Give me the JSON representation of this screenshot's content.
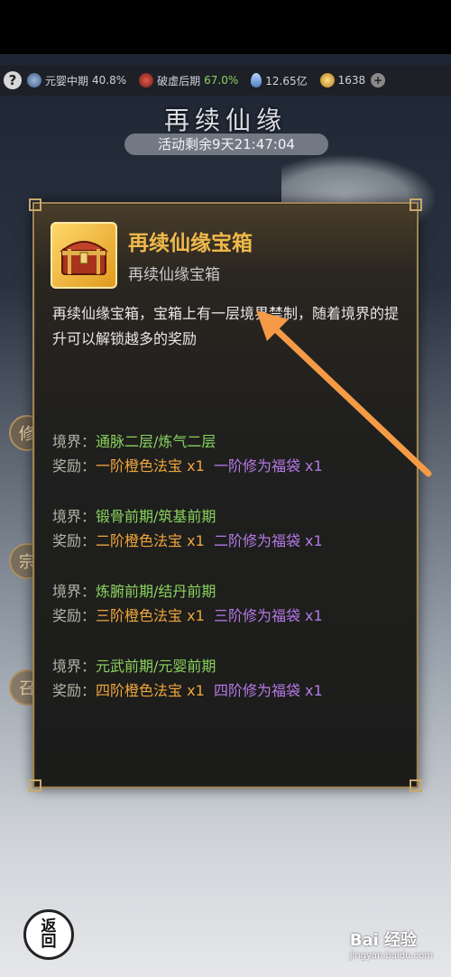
{
  "top_bar": {
    "help_icon": "?",
    "stat1_label": "元婴中期",
    "stat1_value": "40.8%",
    "stat2_label": "破虚后期",
    "stat2_value": "67.0%",
    "stat3_value": "12.65亿",
    "stat4_value": "1638",
    "plus": "+"
  },
  "page": {
    "title": "再续仙缘",
    "countdown": "活动剩余9天21:47:04",
    "side_buttons": [
      "修",
      "宗",
      "召"
    ],
    "back_label_1": "返",
    "back_label_2": "回"
  },
  "modal": {
    "item_name": "再续仙缘宝箱",
    "item_subtitle": "再续仙缘宝箱",
    "description": "再续仙缘宝箱，宝箱上有一层境界禁制，随着境界的提升可以解锁越多的奖励",
    "realm_label": "境界：",
    "reward_label": "奖励：",
    "tiers": [
      {
        "realm": "通脉二层/炼气二层",
        "reward_orange": "一阶橙色法宝 x1",
        "reward_purple": "一阶修为福袋 x1"
      },
      {
        "realm": "锻骨前期/筑基前期",
        "reward_orange": "二阶橙色法宝 x1",
        "reward_purple": "二阶修为福袋 x1"
      },
      {
        "realm": "炼腑前期/结丹前期",
        "reward_orange": "三阶橙色法宝 x1",
        "reward_purple": "三阶修为福袋 x1"
      },
      {
        "realm": "元武前期/元婴前期",
        "reward_orange": "四阶橙色法宝 x1",
        "reward_purple": "四阶修为福袋 x1"
      }
    ]
  },
  "watermark": {
    "brand": "Bai 经验",
    "url": "jingyan.baidu.com"
  },
  "colors": {
    "realm": "#8ad35c",
    "orange": "#f0a63a",
    "purple": "#b47ae6",
    "title_gold": "#f0b94a",
    "arrow": "#f59a45"
  },
  "icons": {
    "help": "help-icon",
    "yuanying": "yuanying-icon",
    "poxu": "poxu-icon",
    "lingshi": "lingshi-icon",
    "coin": "coin-icon",
    "chest": "treasure-chest-icon"
  }
}
